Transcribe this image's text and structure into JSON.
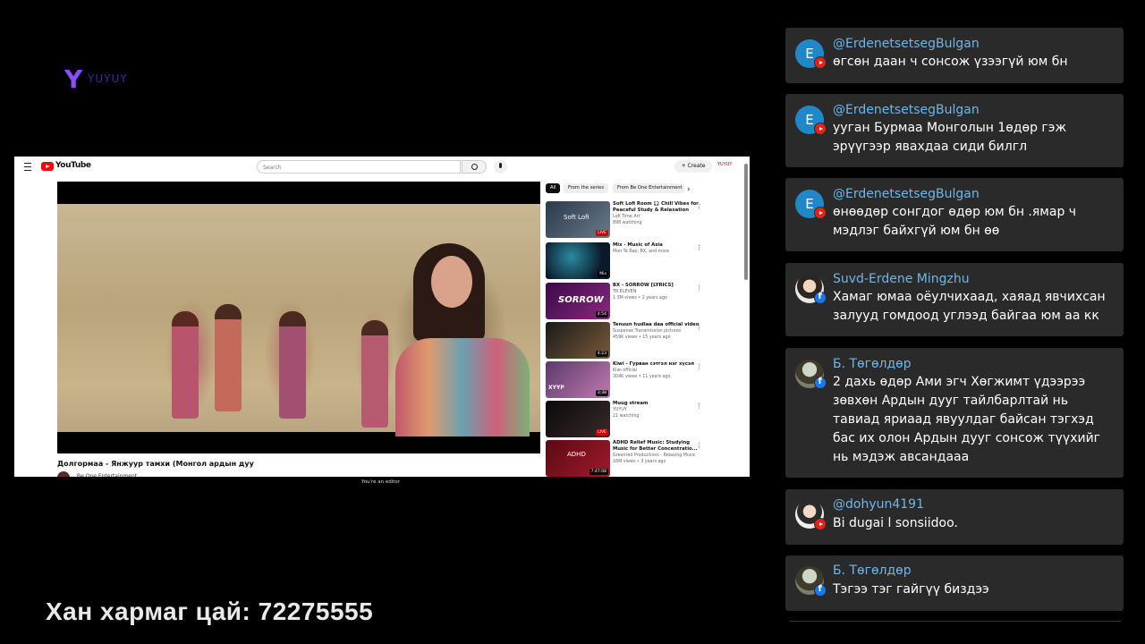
{
  "brand": {
    "logo_letter": "Y",
    "logo_text": "YUYUY"
  },
  "youtube": {
    "app_name": "YouTube",
    "search_placeholder": "Search",
    "create_label": "Create",
    "avatar_label": "YUYUY",
    "video_title": "Долгормаа - Янжуур тамхи (Монгол ардын дуу",
    "channel_name": "Be One Entertainment",
    "chips": [
      "All",
      "From the series",
      "From Be One Entertainment"
    ],
    "editor_notice": "You're an editor",
    "recommendations": [
      {
        "title": "Soft Lofi Room 🎧 Chill Vibes for Peaceful Study & Relaxation",
        "channel": "Lofi Time Art",
        "stats": "898 watching",
        "badge": "LIVE",
        "thumb_text": "Soft Lofi"
      },
      {
        "title": "Mix - Music of Asia",
        "channel": "Mon Ta Rap, BX, and more",
        "stats": "",
        "badge": "Mix",
        "thumb_text": ""
      },
      {
        "title": "BX - SORROW [LYRICS]",
        "channel": "TR ELEVEN",
        "stats": "1.3M views • 2 years ago",
        "badge": "4:54",
        "thumb_text": "SORROW"
      },
      {
        "title": "Tenuun hudlaa daa official video",
        "channel": "Suspense Transmission pictures",
        "stats": "459K views • 15 years ago",
        "badge": "4:23",
        "thumb_text": ""
      },
      {
        "title": "Kiwi - Гурван сэтгэл нэг хүсэл",
        "channel": "Kiwi official",
        "stats": "304K views • 11 years ago",
        "badge": "3:38",
        "thumb_text": "ХҮҮР"
      },
      {
        "title": "Muug stream",
        "channel": "YUYUY",
        "stats": "21 watching",
        "badge": "LIVE",
        "thumb_text": ""
      },
      {
        "title": "ADHD Relief Music: Studying Music for Better Concentratio...",
        "channel": "Greenred Productions - Relaxing Music",
        "stats": "16M views • 3 years ago",
        "badge": "7:47:08",
        "thumb_text": "ADHD"
      }
    ]
  },
  "promo_text": "Хан хармаг цай: 72275555",
  "chat": [
    {
      "author": "@ErdenetsetsegBulgan",
      "text": "өгсөн даан ч сонсож үзээгүй юм бн",
      "avatar_letter": "E",
      "source": "youtube"
    },
    {
      "author": "@ErdenetsetsegBulgan",
      "text": "ууган Бурмаа Монголын 1өдөр гэж эрүүгээр явахдаа сиди билгл",
      "avatar_letter": "E",
      "source": "youtube"
    },
    {
      "author": "@ErdenetsetsegBulgan",
      "text": "өнөөдөр сонгдог өдөр юм бн .ямар ч мэдлэг байхгүй юм бн өө",
      "avatar_letter": "E",
      "source": "youtube"
    },
    {
      "author": "Suvd-Erdene Mingzhu",
      "text": "Хамаг юмаа оёулчихаад, хаяад явчихсан залууд гомдоод углээд байгаа юм аа кк",
      "avatar_letter": "",
      "source": "facebook"
    },
    {
      "author": "Б. Төгөлдөр",
      "text": "2 дахь өдөр Ами эгч Хөгжимт үдээрээ зөвхөн Ардын дууг тайлбарлтай нь тавиад яриаад явуулдаг байсан тэгхэд бас их олон Ардын дууг сонсож түүхийг нь мэдэж авсандааа",
      "avatar_letter": "",
      "source": "facebook"
    },
    {
      "author": "@dohyun4191",
      "text": "Bi dugai l sonsiidoo.",
      "avatar_letter": "",
      "source": "youtube"
    },
    {
      "author": "Б. Төгөлдөр",
      "text": "Тэгээ тэг гайгүү биздээ",
      "avatar_letter": "",
      "source": "facebook"
    }
  ]
}
